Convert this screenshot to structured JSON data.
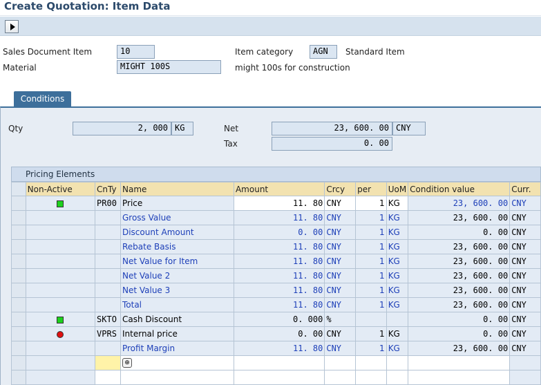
{
  "window": {
    "title": "Create Quotation: Item Data"
  },
  "header": {
    "sales_doc_item_label": "Sales Document Item",
    "sales_doc_item_value": "10",
    "item_category_label": "Item category",
    "item_category_value": "AGN",
    "item_category_text": "Standard Item",
    "material_label": "Material",
    "material_value": "MIGHT 100S",
    "material_description": "might 100s for construction"
  },
  "tabs": [
    {
      "label": "Conditions"
    }
  ],
  "conditions": {
    "qty_label": "Qty",
    "qty_value": "2, 000",
    "qty_unit": "KG",
    "net_label": "Net",
    "net_value": "23, 600. 00",
    "net_currency": "CNY",
    "tax_label": "Tax",
    "tax_value": "0. 00"
  },
  "pricing": {
    "section_title": "Pricing Elements",
    "columns": [
      "Non-Active",
      "CnTy",
      "Name",
      "Amount",
      "Crcy",
      "per",
      "UoM",
      "Condition value",
      "Curr."
    ],
    "rows": [
      {
        "status": "green",
        "cnty": "PR00",
        "name": "Price",
        "amount": "11. 80",
        "crcy": "CNY",
        "per": "1",
        "uom": "KG",
        "value": "23, 600. 00",
        "curr": "CNY",
        "style": "editable"
      },
      {
        "status": "",
        "cnty": "",
        "name": "Gross Value",
        "amount": "11. 80",
        "crcy": "CNY",
        "per": "1",
        "uom": "KG",
        "value": "23, 600. 00",
        "curr": "CNY",
        "style": "subtotal"
      },
      {
        "status": "",
        "cnty": "",
        "name": "Discount Amount",
        "amount": "0. 00",
        "crcy": "CNY",
        "per": "1",
        "uom": "KG",
        "value": "0. 00",
        "curr": "CNY",
        "style": "subtotal"
      },
      {
        "status": "",
        "cnty": "",
        "name": "Rebate Basis",
        "amount": "11. 80",
        "crcy": "CNY",
        "per": "1",
        "uom": "KG",
        "value": "23, 600. 00",
        "curr": "CNY",
        "style": "subtotal"
      },
      {
        "status": "",
        "cnty": "",
        "name": "Net Value for Item",
        "amount": "11. 80",
        "crcy": "CNY",
        "per": "1",
        "uom": "KG",
        "value": "23, 600. 00",
        "curr": "CNY",
        "style": "subtotal"
      },
      {
        "status": "",
        "cnty": "",
        "name": "Net Value 2",
        "amount": "11. 80",
        "crcy": "CNY",
        "per": "1",
        "uom": "KG",
        "value": "23, 600. 00",
        "curr": "CNY",
        "style": "subtotal"
      },
      {
        "status": "",
        "cnty": "",
        "name": "Net Value 3",
        "amount": "11. 80",
        "crcy": "CNY",
        "per": "1",
        "uom": "KG",
        "value": "23, 600. 00",
        "curr": "CNY",
        "style": "subtotal"
      },
      {
        "status": "",
        "cnty": "",
        "name": "Total",
        "amount": "11. 80",
        "crcy": "CNY",
        "per": "1",
        "uom": "KG",
        "value": "23, 600. 00",
        "curr": "CNY",
        "style": "subtotal"
      },
      {
        "status": "green",
        "cnty": "SKTO",
        "name": "Cash Discount",
        "amount": "0. 000",
        "crcy": "%",
        "per": "",
        "uom": "",
        "value": "0. 00",
        "curr": "CNY",
        "style": "normal"
      },
      {
        "status": "red",
        "cnty": "VPRS",
        "name": "Internal price",
        "amount": "0. 00",
        "crcy": "CNY",
        "per": "1",
        "uom": "KG",
        "value": "0. 00",
        "curr": "CNY",
        "style": "normal"
      },
      {
        "status": "",
        "cnty": "",
        "name": "Profit Margin",
        "amount": "11. 80",
        "crcy": "CNY",
        "per": "1",
        "uom": "KG",
        "value": "23, 600. 00",
        "curr": "CNY",
        "style": "subtotal"
      }
    ]
  },
  "icons": {
    "execute": "execute-triangle-icon",
    "active": "green-square-icon",
    "inactive": "red-circle-icon",
    "new_entry": "new-entry-icon"
  },
  "colors": {
    "header_bg": "#f2e2b0",
    "subtotal_text": "#1d3fb8",
    "tab_bg": "#3d6f9b"
  }
}
